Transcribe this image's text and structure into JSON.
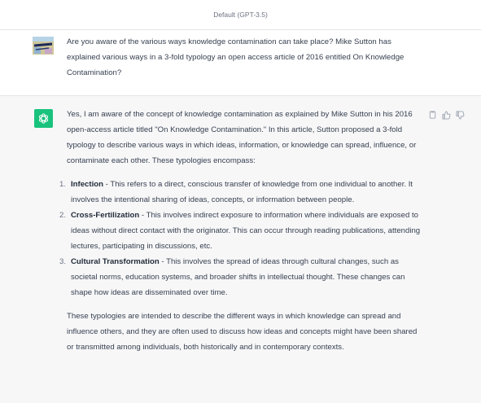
{
  "header": {
    "model_label": "Default (GPT-3.5)"
  },
  "user_message": {
    "avatar_icon": "user-avatar-dysology",
    "text": "Are you aware of the various ways knowledge contamination can take place? Mike Sutton has explained various ways in a 3-fold typology an open access article of 2016 entitled On Knowledge Contamination?"
  },
  "assistant_message": {
    "avatar_icon": "openai-logo-icon",
    "intro": "Yes, I am aware of the concept of knowledge contamination as explained by Mike Sutton in his 2016 open-access article titled \"On Knowledge Contamination.\" In this article, Sutton proposed a 3-fold typology to describe various ways in which ideas, information, or knowledge can spread, influence, or contaminate each other. These typologies encompass:",
    "items": [
      {
        "number": "1.",
        "title": "Infection",
        "text": " - This refers to a direct, conscious transfer of knowledge from one individual to another. It involves the intentional sharing of ideas, concepts, or information between people."
      },
      {
        "number": "2.",
        "title": "Cross-Fertilization",
        "text": " - This involves indirect exposure to information where individuals are exposed to ideas without direct contact with the originator. This can occur through reading publications, attending lectures, participating in discussions, etc."
      },
      {
        "number": "3.",
        "title": "Cultural Transformation",
        "text": " - This involves the spread of ideas through cultural changes, such as societal norms, education systems, and broader shifts in intellectual thought. These changes can shape how ideas are disseminated over time."
      }
    ],
    "closing": "These typologies are intended to describe the different ways in which knowledge can spread and influence others, and they are often used to discuss how ideas and concepts might have been shared or transmitted among individuals, both historically and in contemporary contexts.",
    "actions": [
      {
        "icon": "copy-icon"
      },
      {
        "icon": "thumbs-up-icon"
      },
      {
        "icon": "thumbs-down-icon"
      }
    ]
  },
  "colors": {
    "bot_avatar": "#19c37d",
    "assistant_bg": "#f7f7f8"
  }
}
